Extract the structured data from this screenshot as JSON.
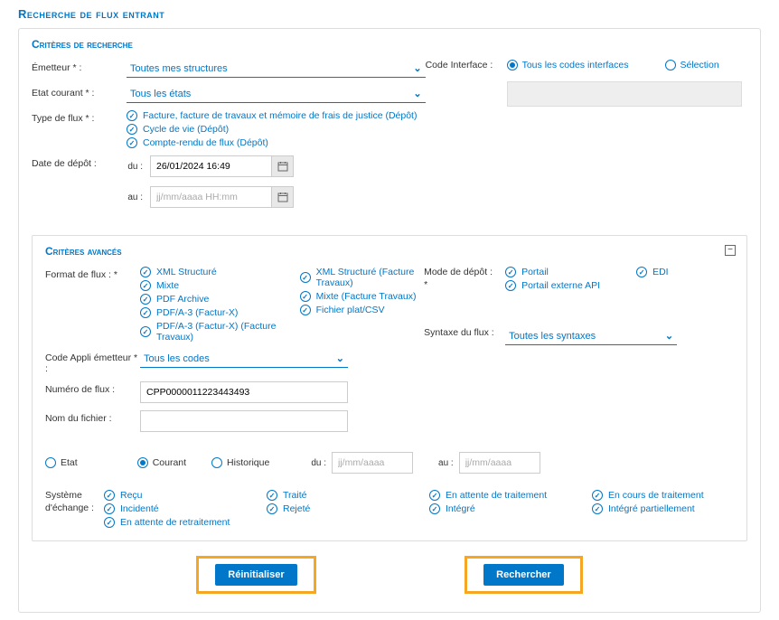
{
  "page_title": "Recherche de flux entrant",
  "section_criteria": "Critères de recherche",
  "section_advanced": "Critères avancés",
  "fields": {
    "emitter_label": "Émetteur * :",
    "emitter_value": "Toutes mes structures",
    "state_label": "Etat courant * :",
    "state_value": "Tous les états",
    "flowtype_label": "Type de flux * :",
    "flowtype_opts": [
      "Facture, facture de travaux et mémoire de frais de justice (Dépôt)",
      "Cycle de vie (Dépôt)",
      "Compte-rendu de flux (Dépôt)"
    ],
    "deposit_date_label": "Date de dépôt :",
    "date_from_label": "du :",
    "date_from_value": "26/01/2024 16:49",
    "date_to_label": "au :",
    "date_to_placeholder": "jj/mm/aaaa HH:mm",
    "code_interface_label": "Code Interface :",
    "code_interface_all": "Tous les codes interfaces",
    "code_interface_sel": "Sélection",
    "format_label": "Format de flux : *",
    "format_col1": [
      "XML Structuré",
      "Mixte",
      "PDF Archive",
      "PDF/A-3 (Factur-X)",
      "PDF/A-3 (Factur-X) (Facture Travaux)"
    ],
    "format_col2": [
      "XML Structuré (Facture Travaux)",
      "Mixte (Facture Travaux)",
      "Fichier plat/CSV"
    ],
    "mode_depot_label": "Mode de dépôt : *",
    "mode_depot_opts1": [
      "Portail",
      "Portail externe API"
    ],
    "mode_depot_opts2": [
      "EDI"
    ],
    "code_appli_label": "Code Appli émetteur * :",
    "code_appli_value": "Tous les codes",
    "syntax_label": "Syntaxe du flux :",
    "syntax_value": "Toutes les syntaxes",
    "numero_label": "Numéro de flux :",
    "numero_value": "CPP0000011223443493",
    "nom_fichier_label": "Nom du fichier :",
    "etat_label": "Etat",
    "etat_courant": "Courant",
    "etat_historique": "Historique",
    "etat_du": "du :",
    "etat_au": "au :",
    "etat_date_placeholder": "jj/mm/aaaa",
    "systeme_label": "Système d'échange :",
    "systeme_col1": [
      "Reçu",
      "Incidenté",
      "En attente de retraitement"
    ],
    "systeme_col2": [
      "Traité",
      "Rejeté"
    ],
    "systeme_col3": [
      "En attente de traitement",
      "Intégré"
    ],
    "systeme_col4": [
      "En cours de traitement",
      "Intégré partiellement"
    ]
  },
  "buttons": {
    "reset": "Réinitialiser",
    "search": "Rechercher"
  }
}
